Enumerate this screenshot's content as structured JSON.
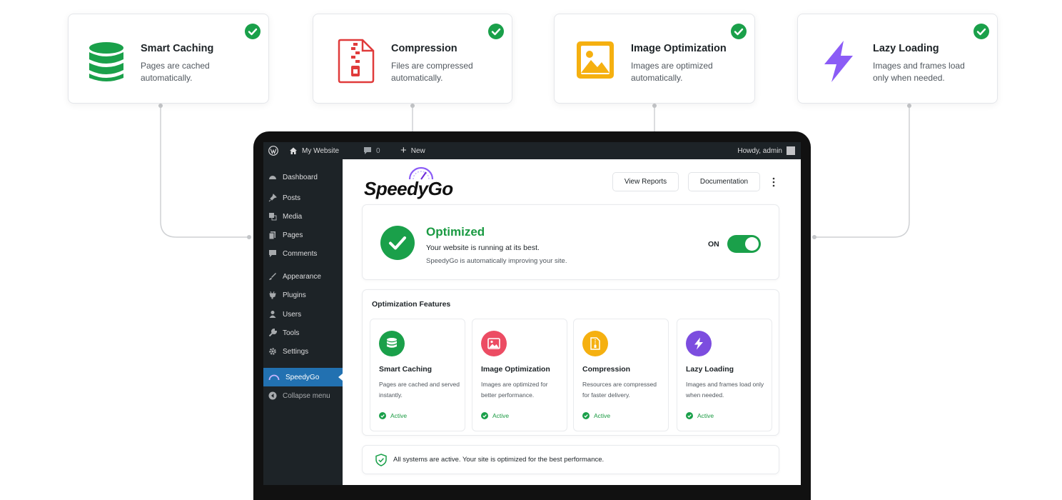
{
  "features_top": [
    {
      "title": "Smart Caching",
      "desc": "Pages are cached automatically.",
      "icon": "database-icon"
    },
    {
      "title": "Compression",
      "desc": "Files are compressed automatically.",
      "icon": "zip-file-icon"
    },
    {
      "title": "Image Optimization",
      "desc": "Images are optimized automatically.",
      "icon": "image-icon"
    },
    {
      "title": "Lazy Loading",
      "desc": "Images and frames load only when needed.",
      "icon": "lightning-icon"
    }
  ],
  "adminbar": {
    "site": "My Website",
    "comments": "0",
    "new": "New",
    "greeting": "Howdy, admin"
  },
  "sidebar": {
    "items": [
      "Dashboard",
      "Posts",
      "Media",
      "Pages",
      "Comments",
      "Appearance",
      "Plugins",
      "Users",
      "Tools",
      "Settings",
      "SpeedyGo",
      "Collapse menu"
    ]
  },
  "header": {
    "logo": "SpeedyGo",
    "view_reports": "View Reports",
    "documentation": "Documentation"
  },
  "status": {
    "title": "Optimized",
    "line1": "Your website is running at its best.",
    "line2": "SpeedyGo is automatically improving your site.",
    "toggle_label": "ON",
    "toggle_on": true
  },
  "features": {
    "heading": "Optimization Features",
    "cards": [
      {
        "title": "Smart Caching",
        "desc": "Pages are cached and served instantly.",
        "status": "Active",
        "color": "#1aa04a",
        "icon": "database-icon"
      },
      {
        "title": "Image Optimization",
        "desc": "Images are optimized for better performance.",
        "status": "Active",
        "color": "#ec4c63",
        "icon": "image-icon"
      },
      {
        "title": "Compression",
        "desc": "Resources are compressed for faster delivery.",
        "status": "Active",
        "color": "#f5b010",
        "icon": "zip-file-icon"
      },
      {
        "title": "Lazy Loading",
        "desc": "Images and frames load only when needed.",
        "status": "Active",
        "color": "#7c4ddf",
        "icon": "lightning-icon"
      }
    ]
  },
  "footer_note": "All systems are active. Your site is optimized for the best performance.",
  "colors": {
    "green": "#1aa04a",
    "wp_dark": "#1d2327",
    "wp_blue": "#2271b1",
    "purple": "#8b5cf6"
  }
}
